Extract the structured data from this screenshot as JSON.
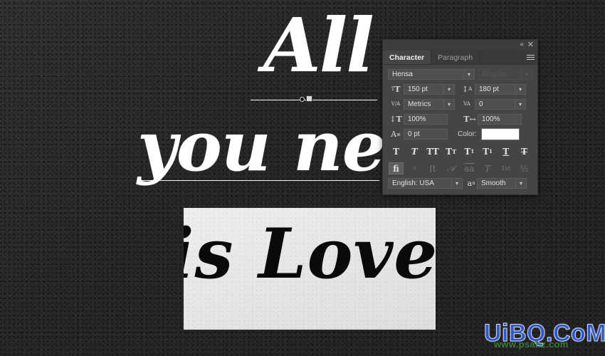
{
  "artwork": {
    "line1": "All",
    "line2": "you ne",
    "pasted_block_text": "is Love"
  },
  "watermark": {
    "main": "UiBQ.CoM",
    "sub": "www.psahz.com"
  },
  "panel": {
    "titlebar": {
      "collapse_icon": "«",
      "close_icon": "✕"
    },
    "tabs": [
      {
        "label": "Character",
        "active": true
      },
      {
        "label": "Paragraph",
        "active": false
      }
    ],
    "menu_icon": "hamburger-menu-icon",
    "font": {
      "family_value": "Hensa",
      "style_value": "Regular",
      "style_disabled": true
    },
    "size": {
      "icon": "T",
      "value": "150 pt",
      "leading_icon": "A",
      "leading_value": "180 pt"
    },
    "kerning": {
      "icon": "V/A",
      "value": "Metrics",
      "tracking_icon": "VA",
      "tracking_value": "0"
    },
    "scale": {
      "vertical_icon": "T",
      "vertical_value": "100%",
      "horizontal_icon": "T",
      "horizontal_value": "100%"
    },
    "baseline": {
      "icon": "Aₐ",
      "value": "0 pt"
    },
    "color": {
      "label": "Color:",
      "value": "#ffffff"
    },
    "style_buttons": [
      {
        "name": "faux-bold",
        "glyph": "T",
        "state": "normal"
      },
      {
        "name": "faux-italic",
        "glyph": "T",
        "state": "italic"
      },
      {
        "name": "all-caps",
        "glyph": "TT",
        "state": "normal"
      },
      {
        "name": "small-caps",
        "glyph": "T",
        "sup": "T",
        "state": "normal"
      },
      {
        "name": "superscript",
        "glyph": "T",
        "sup": "1",
        "state": "normal"
      },
      {
        "name": "subscript",
        "glyph": "T",
        "sub": "1",
        "state": "normal"
      },
      {
        "name": "underline",
        "glyph": "T",
        "state": "underline"
      },
      {
        "name": "strikethrough",
        "glyph": "T",
        "state": "strike"
      }
    ],
    "opentype_buttons": [
      {
        "name": "standard-ligatures",
        "glyph": "fi",
        "active": true,
        "dim": false
      },
      {
        "name": "contextual-alternates",
        "glyph": "ᵒ̵",
        "active": false,
        "dim": true
      },
      {
        "name": "discretionary-ligatures",
        "glyph": "ſt",
        "active": false,
        "dim": true
      },
      {
        "name": "swash",
        "glyph": "𝒜",
        "active": false,
        "dim": true
      },
      {
        "name": "oldstyle",
        "glyph": "aa",
        "active": false,
        "dim": true
      },
      {
        "name": "titling-alternates",
        "glyph": "T",
        "active": false,
        "dim": true
      },
      {
        "name": "ordinals",
        "glyph": "1st",
        "active": false,
        "dim": true
      },
      {
        "name": "fractions",
        "glyph": "½",
        "active": false,
        "dim": true
      }
    ],
    "language": {
      "value": "English: USA"
    },
    "antialias": {
      "icon": "aₐ",
      "value": "Smooth"
    }
  },
  "colors": {
    "panel_bg": "#454545",
    "panel_field": "#4f4f4f",
    "canvas_bg": "#2b2b2b",
    "accent_text": "#ffffff",
    "watermark_blue": "#2f57c9",
    "watermark_green": "#3d8b3d"
  }
}
